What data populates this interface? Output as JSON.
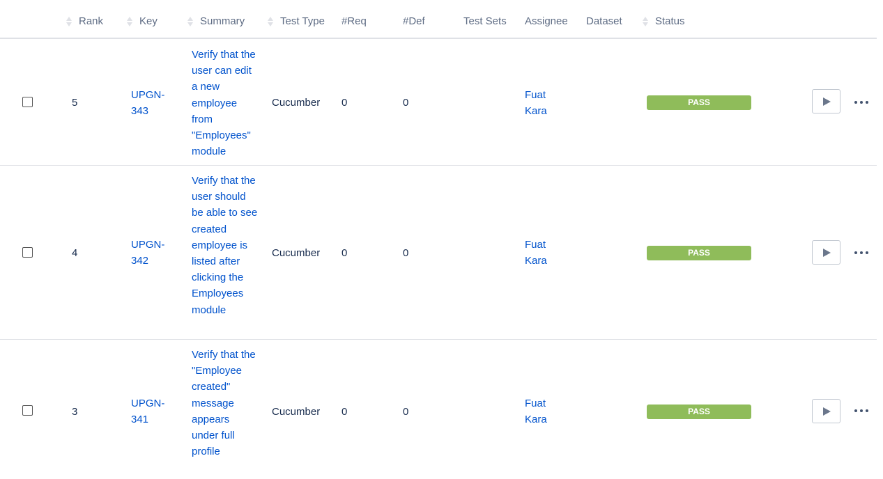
{
  "headers": {
    "rank": "Rank",
    "key": "Key",
    "summary": "Summary",
    "test_type": "Test Type",
    "req": "#Req",
    "def": "#Def",
    "test_sets": "Test Sets",
    "assignee": "Assignee",
    "dataset": "Dataset",
    "status": "Status"
  },
  "rows": [
    {
      "rank": "5",
      "key": "UPGN-343",
      "summary": "Verify that the user can edit a new employee from \"Employees\" module",
      "test_type": "Cucumber",
      "req": "0",
      "def": "0",
      "assignee": "Fuat Kara",
      "status": "PASS"
    },
    {
      "rank": "4",
      "key": "UPGN-342",
      "summary": "Verify that the user should be able to see created employee is listed after clicking the Employees module",
      "test_type": "Cucumber",
      "req": "0",
      "def": "0",
      "assignee": "Fuat Kara",
      "status": "PASS"
    },
    {
      "rank": "3",
      "key": "UPGN-341",
      "summary": "Verify that the \"Employee created\" message appears under full profile",
      "test_type": "Cucumber",
      "req": "0",
      "def": "0",
      "assignee": "Fuat Kara",
      "status": "PASS"
    }
  ],
  "colors": {
    "pass": "#8fbc5a",
    "link": "#0052cc",
    "header_text": "#5e6c84"
  },
  "icons": {
    "play": "play-icon",
    "more": "more-icon",
    "sort": "sort-icon"
  }
}
